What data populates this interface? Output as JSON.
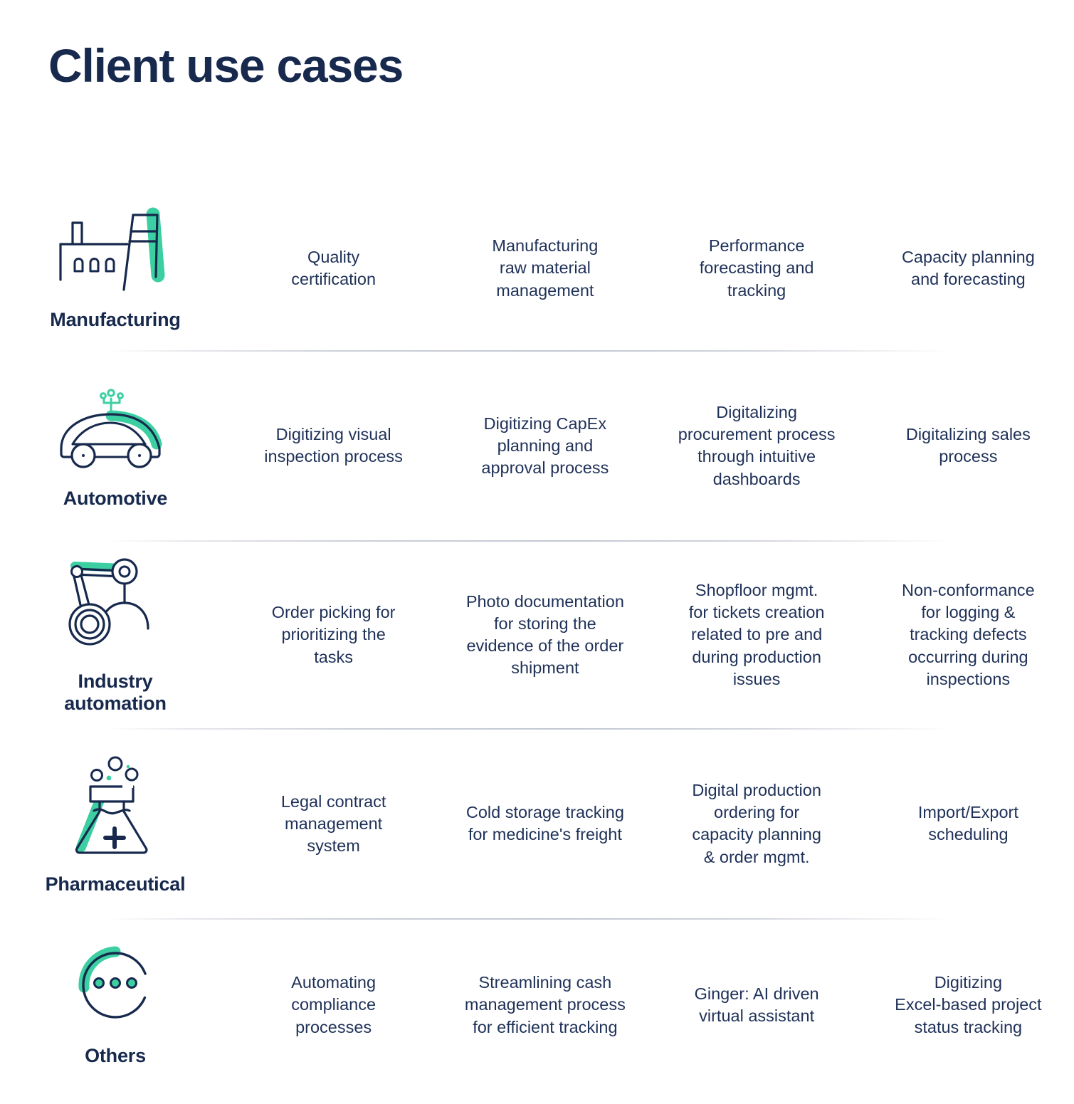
{
  "header": {
    "title": "Client use cases"
  },
  "colors": {
    "navy": "#17294d",
    "body_navy": "#1f3158",
    "accent_green": "#3ccfa2",
    "background": "#ffffff",
    "divider": "#b9c2d0"
  },
  "rows": [
    {
      "id": "manufacturing",
      "label": "Manufacturing",
      "icon": "factory-icon",
      "usecases": [
        "Quality\ncertification",
        "Manufacturing\nraw material\nmanagement",
        "Performance\nforecasting and\ntracking",
        "Capacity planning\nand forecasting"
      ]
    },
    {
      "id": "automotive",
      "label": "Automotive",
      "icon": "connected-car-icon",
      "usecases": [
        "Digitizing visual\ninspection process",
        "Digitizing CapEx\nplanning and\napproval process",
        "Digitalizing\nprocurement process\nthrough intuitive\ndashboards",
        "Digitalizing sales\nprocess"
      ]
    },
    {
      "id": "industry-automation",
      "label": "Industry\nautomation",
      "icon": "robot-arm-icon",
      "usecases": [
        "Order picking for\nprioritizing the\ntasks",
        "Photo documentation\nfor storing the\nevidence of the order\nshipment",
        "Shopfloor mgmt.\nfor tickets creation\nrelated to pre and\nduring production\nissues",
        "Non-conformance\nfor logging &\ntracking defects\noccurring during\ninspections"
      ]
    },
    {
      "id": "pharmaceutical",
      "label": "Pharmaceutical",
      "icon": "flask-icon",
      "usecases": [
        "Legal contract\nmanagement\nsystem",
        "Cold storage tracking\nfor medicine's freight",
        "Digital production\nordering for\ncapacity planning\n& order mgmt.",
        "Import/Export\nscheduling"
      ]
    },
    {
      "id": "others",
      "label": "Others",
      "icon": "ellipsis-circle-icon",
      "usecases": [
        "Automating\ncompliance\nprocesses",
        "Streamlining cash\nmanagement process\nfor efficient tracking",
        "Ginger: AI driven\nvirtual assistant",
        "Digitizing\nExcel-based project\nstatus tracking"
      ]
    }
  ]
}
